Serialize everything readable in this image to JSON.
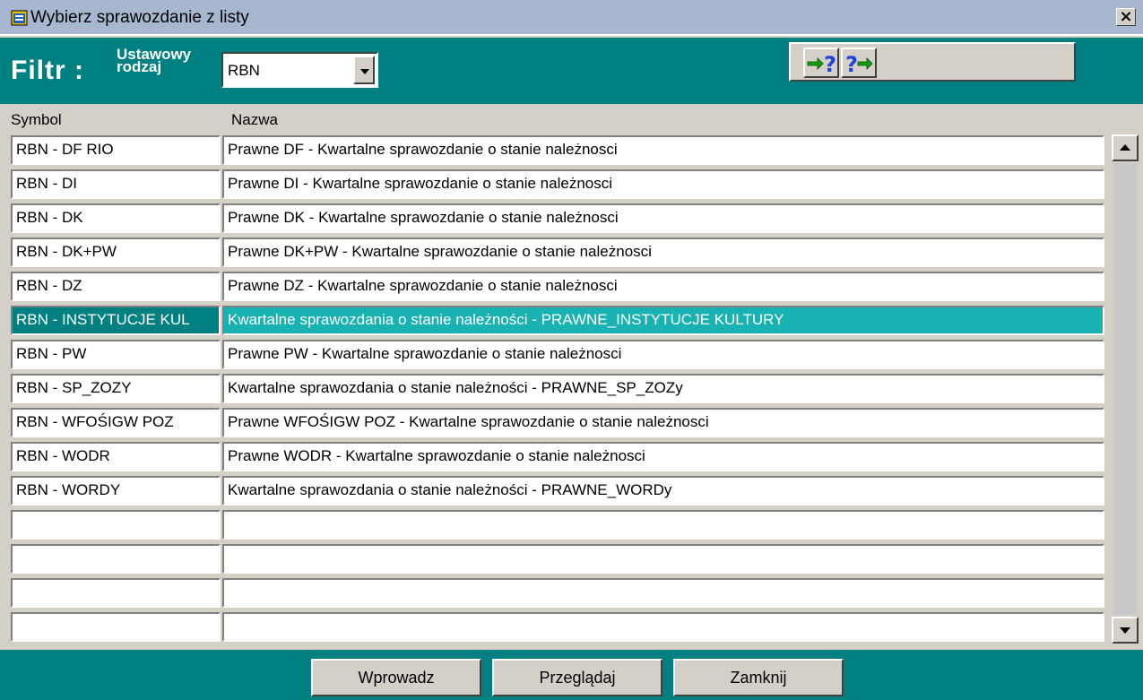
{
  "window": {
    "title": "Wybierz sprawozdanie z listy",
    "close_label": "×"
  },
  "filter": {
    "label": "Filtr :",
    "rodzaj_line1": "Ustawowy",
    "rodzaj_line2": "rodzaj",
    "selected_value": "RBN"
  },
  "columns": {
    "symbol": "Symbol",
    "nazwa": "Nazwa"
  },
  "rows": [
    {
      "symbol": "RBN - DF RIO",
      "nazwa": "Prawne DF - Kwartalne sprawozdanie o stanie należnosci"
    },
    {
      "symbol": "RBN - DI",
      "nazwa": "Prawne DI - Kwartalne sprawozdanie o stanie należnosci"
    },
    {
      "symbol": "RBN - DK",
      "nazwa": "Prawne DK - Kwartalne sprawozdanie o stanie należnosci"
    },
    {
      "symbol": "RBN - DK+PW",
      "nazwa": "Prawne DK+PW - Kwartalne sprawozdanie o stanie należnosci"
    },
    {
      "symbol": "RBN - DZ",
      "nazwa": "Prawne DZ - Kwartalne sprawozdanie o stanie należnosci"
    },
    {
      "symbol": "RBN - INSTYTUCJE KUL",
      "nazwa": "Kwartalne sprawozdania o stanie należności - PRAWNE_INSTYTUCJE KULTURY"
    },
    {
      "symbol": "RBN - PW",
      "nazwa": "Prawne PW - Kwartalne sprawozdanie o stanie należnosci"
    },
    {
      "symbol": "RBN - SP_ZOZY",
      "nazwa": "Kwartalne sprawozdania o stanie należności - PRAWNE_SP_ZOZy"
    },
    {
      "symbol": "RBN - WFOŚIGW POZ",
      "nazwa": "Prawne WFOŚIGW POZ - Kwartalne sprawozdanie o stanie należnosci"
    },
    {
      "symbol": "RBN - WODR",
      "nazwa": "Prawne WODR - Kwartalne sprawozdanie o stanie należnosci"
    },
    {
      "symbol": "RBN - WORDY",
      "nazwa": "Kwartalne sprawozdania o stanie należności - PRAWNE_WORDy"
    },
    {
      "symbol": "",
      "nazwa": ""
    },
    {
      "symbol": "",
      "nazwa": ""
    },
    {
      "symbol": "",
      "nazwa": ""
    },
    {
      "symbol": "",
      "nazwa": ""
    }
  ],
  "selected_row": 5,
  "buttons": {
    "wprowadz": "Wprowadz",
    "przegladaj": "Przeglądaj",
    "zamknij": "Zamknij"
  },
  "icons": {
    "title": "app-window-icon",
    "help_prev": "arrow-question-icon",
    "help_next": "question-arrow-icon",
    "combo": "chevron-down-icon",
    "scroll_up": "scroll-up-arrow-icon",
    "scroll_down": "scroll-down-arrow-icon"
  },
  "colors": {
    "teal": "#008080",
    "selection": "#19b2b2",
    "titlebar": "#a6b7cf",
    "face": "#d4d0c8"
  }
}
